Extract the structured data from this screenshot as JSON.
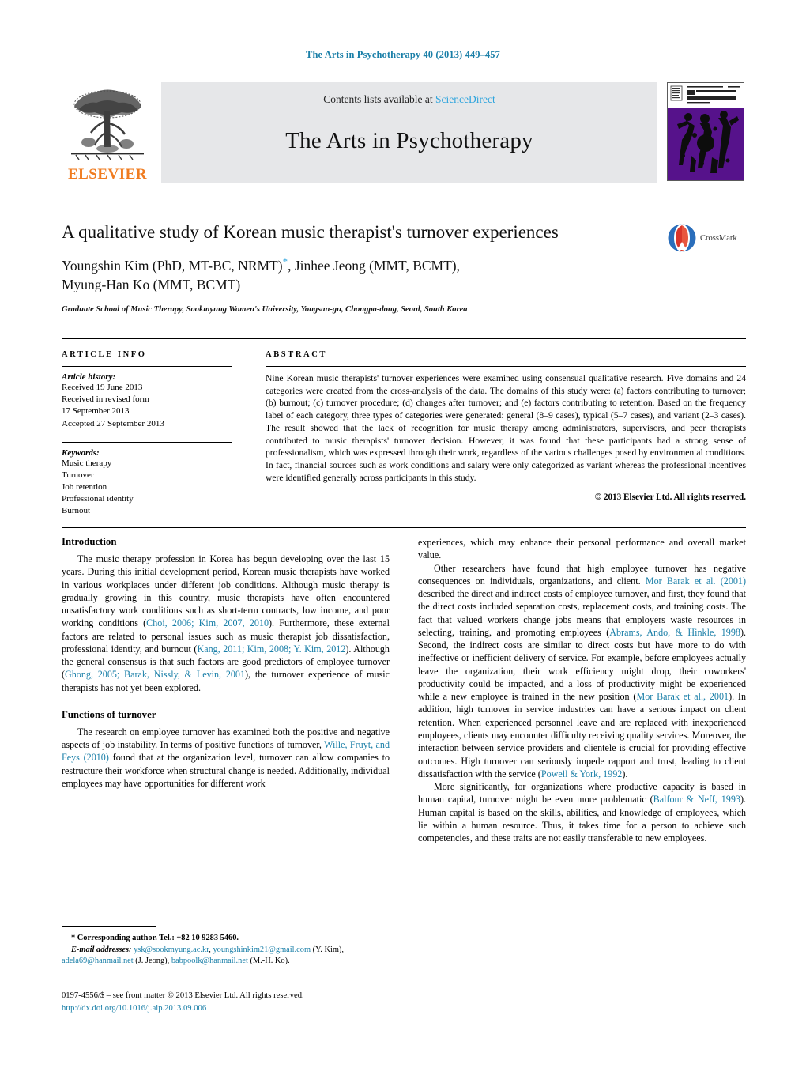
{
  "running_head": "The Arts in Psychotherapy 40 (2013) 449–457",
  "masthead": {
    "contents_prefix": "Contents lists available at ",
    "sciencedirect": "ScienceDirect",
    "journal_title": "The Arts in Psychotherapy",
    "publisher_wordmark": "ELSEVIER",
    "cover_line1": "THE ARTS IN PSYCHOTHERAPY",
    "cover_line2": "THE ARTS IN",
    "cover_line3": "PSYCHOTHERAPY",
    "accent_link": "#2da4dd",
    "cover_purple": "#56128b",
    "elsevier_orange": "#F07C20"
  },
  "article": {
    "title": "A qualitative study of Korean music therapist's turnover experiences",
    "authors_line1": "Youngshin Kim (PhD, MT-BC, NRMT)",
    "authors_line1_rest": ", Jinhee Jeong (MMT, BCMT),",
    "authors_line2": "Myung-Han Ko (MMT, BCMT)",
    "affiliation": "Graduate School of Music Therapy, Sookmyung Women's University, Yongsan-gu, Chongpa-dong, Seoul, South Korea",
    "crossmark_label": "CrossMark"
  },
  "article_info": {
    "heading": "ARTICLE INFO",
    "history_label": "Article history:",
    "history": [
      "Received 19 June 2013",
      "Received in revised form",
      "17 September 2013",
      "Accepted 27 September 2013"
    ],
    "keywords_label": "Keywords:",
    "keywords": [
      "Music therapy",
      "Turnover",
      "Job retention",
      "Professional identity",
      "Burnout"
    ]
  },
  "abstract": {
    "heading": "ABSTRACT",
    "text": "Nine Korean music therapists' turnover experiences were examined using consensual qualitative research. Five domains and 24 categories were created from the cross-analysis of the data. The domains of this study were: (a) factors contributing to turnover; (b) burnout; (c) turnover procedure; (d) changes after turnover; and (e) factors contributing to retention. Based on the frequency label of each category, three types of categories were generated: general (8–9 cases), typical (5–7 cases), and variant (2–3 cases). The result showed that the lack of recognition for music therapy among administrators, supervisors, and peer therapists contributed to music therapists' turnover decision. However, it was found that these participants had a strong sense of professionalism, which was expressed through their work, regardless of the various challenges posed by environmental conditions. In fact, financial sources such as work conditions and salary were only categorized as variant whereas the professional incentives were identified generally across participants in this study.",
    "copyright": "© 2013 Elsevier Ltd. All rights reserved."
  },
  "body": {
    "left": {
      "intro_heading": "Introduction",
      "intro_p1_a": "The music therapy profession in Korea has begun developing over the last 15 years. During this initial development period, Korean music therapists have worked in various workplaces under different job conditions. Although music therapy is gradually growing in this country, music therapists have often encountered unsatisfactory work conditions such as short-term contracts, low income, and poor working conditions (",
      "intro_p1_ref1": "Choi, 2006; Kim, 2007, 2010",
      "intro_p1_b": "). Furthermore, these external factors are related to personal issues such as music therapist job dissatisfaction, professional identity, and burnout (",
      "intro_p1_ref2": "Kang, 2011; Kim, 2008; Y. Kim, 2012",
      "intro_p1_c": "). Although the general consensus is that such factors are good predictors of employee turnover (",
      "intro_p1_ref3": "Ghong, 2005; Barak, Nissly, & Levin, 2001",
      "intro_p1_d": "), the turnover experience of music therapists has not yet been explored.",
      "functions_heading": "Functions of turnover",
      "functions_p1_a": "The research on employee turnover has examined both the positive and negative aspects of job instability. In terms of positive functions of turnover, ",
      "functions_p1_ref1": "Wille, Fruyt, and Feys (2010)",
      "functions_p1_b": " found that at the organization level, turnover can allow companies to restructure their workforce when structural change is needed. Additionally, individual employees may have opportunities for different work"
    },
    "right": {
      "p1": "experiences, which may enhance their personal performance and overall market value.",
      "p2_a": "Other researchers have found that high employee turnover has negative consequences on individuals, organizations, and client. ",
      "p2_ref1": "Mor Barak et al. (2001)",
      "p2_b": " described the direct and indirect costs of employee turnover, and first, they found that the direct costs included separation costs, replacement costs, and training costs. The fact that valued workers change jobs means that employers waste resources in selecting, training, and promoting employees (",
      "p2_ref2": "Abrams, Ando, & Hinkle, 1998",
      "p2_c": "). Second, the indirect costs are similar to direct costs but have more to do with ineffective or inefficient delivery of service. For example, before employees actually leave the organization, their work efficiency might drop, their coworkers' productivity could be impacted, and a loss of productivity might be experienced while a new employee is trained in the new position (",
      "p2_ref3": "Mor Barak et al., 2001",
      "p2_d": "). In addition, high turnover in service industries can have a serious impact on client retention. When experienced personnel leave and are replaced with inexperienced employees, clients may encounter difficulty receiving quality services. Moreover, the interaction between service providers and clientele is crucial for providing effective outcomes. High turnover can seriously impede rapport and trust, leading to client dissatisfaction with the service (",
      "p2_ref4": "Powell & York, 1992",
      "p2_e": ").",
      "p3_a": "More significantly, for organizations where productive capacity is based in human capital, turnover might be even more problematic (",
      "p3_ref1": "Balfour & Neff, 1993",
      "p3_b": "). Human capital is based on the skills, abilities, and knowledge of employees, which lie within a human resource. Thus, it takes time for a person to achieve such competencies, and these traits are not easily transferable to new employees."
    }
  },
  "footnotes": {
    "corresponding": "* Corresponding author. Tel.: +82 10 9283 5460.",
    "email_label": "E-mail addresses:",
    "email1": "ysk@sookmyung.ac.kr",
    "email_sep1": ", ",
    "email2": "youngshinkim21@gmail.com",
    "email2_owner": " (Y. Kim),",
    "email3": "adela69@hanmail.net",
    "email3_owner": " (J. Jeong), ",
    "email4": "babpoolk@hanmail.net",
    "email4_owner": " (M.-H. Ko)."
  },
  "issn_block": {
    "line1": "0197-4556/$ – see front matter © 2013 Elsevier Ltd. All rights reserved.",
    "doi": "http://dx.doi.org/10.1016/j.aip.2013.09.006"
  }
}
